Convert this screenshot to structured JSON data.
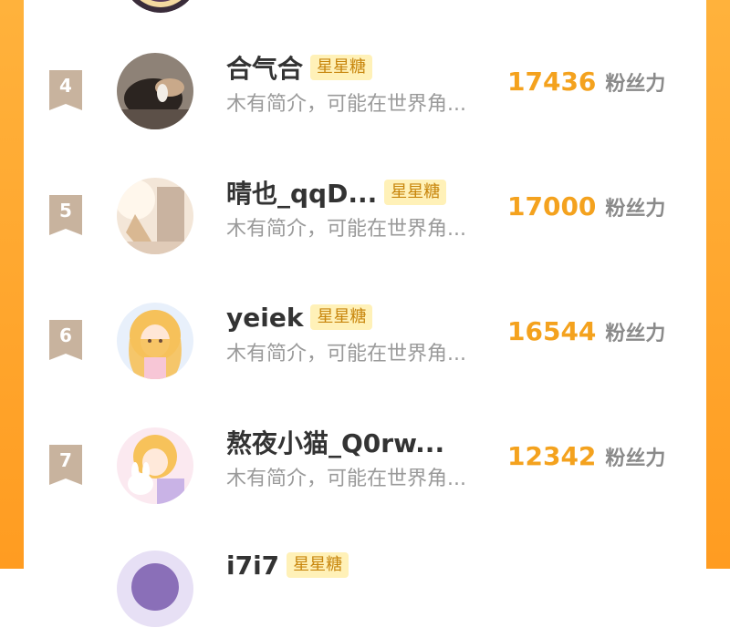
{
  "rows": [
    {
      "rank": "4",
      "name": "合气合",
      "badge": "星星糖",
      "desc": "木有简介，可能在世界角...",
      "fans": "17436",
      "fans_label": "粉丝力",
      "avatar_icon": "cat-photo-avatar"
    },
    {
      "rank": "5",
      "name": "晴也_qqD...",
      "badge": "星星糖",
      "desc": "木有简介，可能在世界角...",
      "fans": "17000",
      "fans_label": "粉丝力",
      "avatar_icon": "sunlit-photo-avatar"
    },
    {
      "rank": "6",
      "name": "yeiek",
      "badge": "星星糖",
      "desc": "木有简介，可能在世界角...",
      "fans": "16544",
      "fans_label": "粉丝力",
      "avatar_icon": "anime-girl-avatar"
    },
    {
      "rank": "7",
      "name": "熬夜小猫_Q0rw...",
      "badge": "",
      "desc": "木有简介，可能在世界角...",
      "fans": "12342",
      "fans_label": "粉丝力",
      "avatar_icon": "anime-girl-bunny-avatar"
    },
    {
      "rank": "",
      "name": "i7i7",
      "badge": "星星糖",
      "desc": "",
      "fans": "",
      "fans_label": "",
      "avatar_icon": "anime-avatar-partial"
    }
  ],
  "colors": {
    "accent_orange": "#ff9c21",
    "fans_count": "#f4a21e",
    "badge_bg": "#fff1b8",
    "rank_ribbon": "#c8b39e"
  }
}
